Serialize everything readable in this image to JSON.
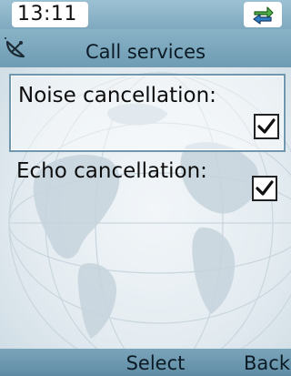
{
  "status_bar": {
    "time": "13:11",
    "sync_icon": "sync-arrows-icon"
  },
  "header": {
    "title": "Call services",
    "icon": "satellite-dish-icon"
  },
  "settings": {
    "items": [
      {
        "label": "Noise cancellation:",
        "checked": true,
        "selected": true
      },
      {
        "label": "Echo cancellation:",
        "checked": true,
        "selected": false
      }
    ]
  },
  "softkeys": {
    "left": "",
    "center": "Select",
    "right": "Back"
  },
  "colors": {
    "bar_blue": "#7fa9bf",
    "selection_border": "#6f97ae"
  }
}
